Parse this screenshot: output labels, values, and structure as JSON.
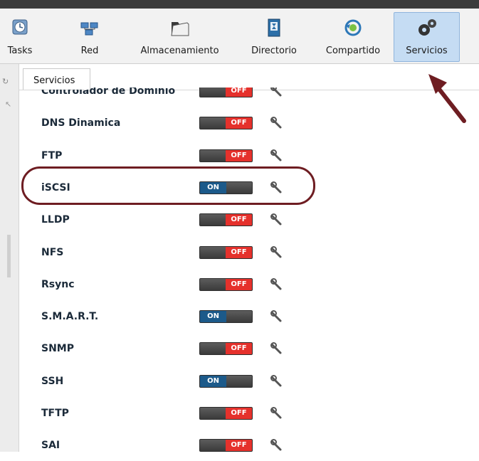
{
  "toolbar": {
    "items": [
      {
        "label": "Tasks",
        "icon": "clock-icon"
      },
      {
        "label": "Red",
        "icon": "network-icon"
      },
      {
        "label": "Almacenamiento",
        "icon": "folder-icon"
      },
      {
        "label": "Directorio",
        "icon": "directory-book-icon"
      },
      {
        "label": "Compartido",
        "icon": "share-icon"
      },
      {
        "label": "Servicios",
        "icon": "gears-icon",
        "active": true
      }
    ]
  },
  "tab": {
    "label": "Servicios"
  },
  "services": [
    {
      "name": "Controlador de Dominio",
      "state": "OFF"
    },
    {
      "name": "DNS Dinamica",
      "state": "OFF"
    },
    {
      "name": "FTP",
      "state": "OFF"
    },
    {
      "name": "iSCSI",
      "state": "ON"
    },
    {
      "name": "LLDP",
      "state": "OFF"
    },
    {
      "name": "NFS",
      "state": "OFF"
    },
    {
      "name": "Rsync",
      "state": "OFF"
    },
    {
      "name": "S.M.A.R.T.",
      "state": "ON"
    },
    {
      "name": "SNMP",
      "state": "OFF"
    },
    {
      "name": "SSH",
      "state": "ON"
    },
    {
      "name": "TFTP",
      "state": "OFF"
    },
    {
      "name": "SAI",
      "state": "OFF"
    }
  ],
  "colors": {
    "on": "#1c5a8a",
    "off": "#e5312c",
    "annotation": "#6e1d22",
    "active_tab": "#c5dcf3"
  }
}
